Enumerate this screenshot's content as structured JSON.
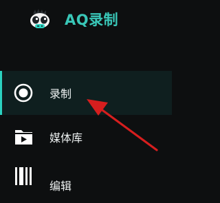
{
  "app": {
    "title": "AQ录制"
  },
  "nav": {
    "items": [
      {
        "label": "录制",
        "icon": "record-icon",
        "active": true
      },
      {
        "label": "媒体库",
        "icon": "media-library-icon",
        "active": false
      },
      {
        "label": "编辑",
        "icon": "edit-icon",
        "active": false
      }
    ]
  },
  "colors": {
    "accent": "#2bd2c0",
    "brand": "#39c7b8",
    "annotation": "#d61e1e",
    "background": "#0d0f10"
  }
}
